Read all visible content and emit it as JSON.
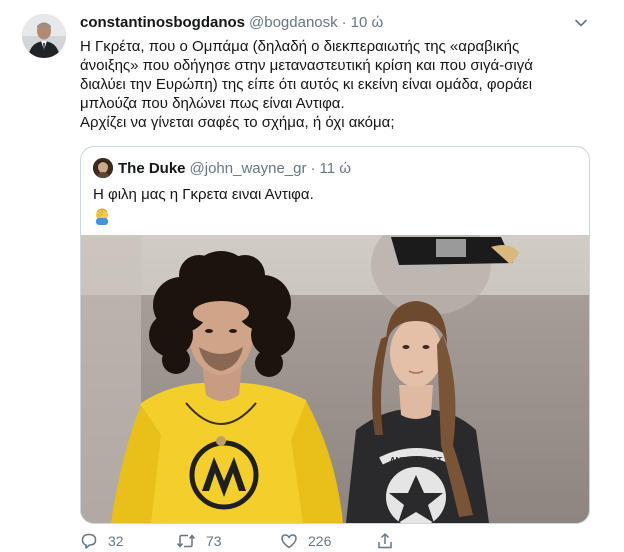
{
  "tweet": {
    "display_name": "constantinosbogdanos",
    "handle": "@bogdanosk",
    "separator": "·",
    "time": "10 ώ",
    "text_lines": [
      "Η Γκρέτα, που ο Ομπάμα (δηλαδή ο διεκπεραιωτής της «αραβικής",
      "άνοιξης» που οδήγησε στην μεταναστευτική κρίση και που σιγά-σιγά",
      "διαλύει την Ευρώπη) της είπε ότι αυτός κι εκείνη είναι ομάδα, φοράει",
      "μπλούζα που δηλώνει πως είναι Αντιφα.",
      "Αρχίζει να γίνεται σαφές το σχήμα, ή όχι ακόμα;"
    ]
  },
  "quoted": {
    "display_name": "The Duke",
    "handle": "@john_wayne_gr",
    "separator": "·",
    "time": "11 ώ",
    "text": "Η φιλη μας η Γκρετα ειναι Αντιφα.",
    "emoji_icon": "facepalm-emoji-icon",
    "photo_shirt_text": "ANTIFASCIST"
  },
  "actions": {
    "reply_count": "32",
    "retweet_count": "73",
    "like_count": "226"
  },
  "colors": {
    "text": "#14171a",
    "muted": "#657786",
    "border": "#ccd6dd",
    "shirt_yellow": "#f2cf2a"
  }
}
